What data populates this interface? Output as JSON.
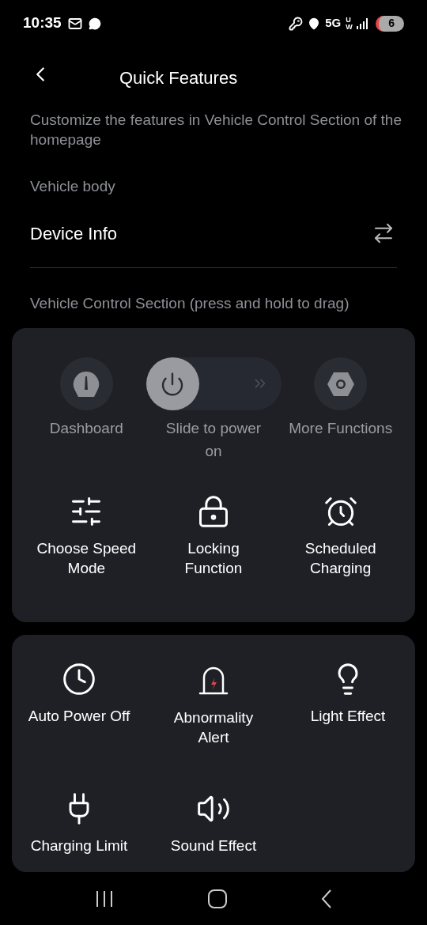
{
  "status_bar": {
    "time": "10:35",
    "network": "5G",
    "network_sub": "UW",
    "battery": "6"
  },
  "header": {
    "title": "Quick Features"
  },
  "description": "Customize the features in Vehicle Control Section of the homepage",
  "vehicle_body": {
    "label": "Vehicle body",
    "item": "Device Info"
  },
  "section_label": "Vehicle Control Section (press and hold to drag)",
  "top_controls": [
    {
      "kind": "dashboard",
      "label": "Dashboard"
    },
    {
      "kind": "slider",
      "label": "Slide to power on",
      "level": 0
    },
    {
      "kind": "more",
      "label": "More Functions"
    }
  ],
  "card_features": [
    {
      "kind": "speed",
      "label": "Choose Speed Mode"
    },
    {
      "kind": "lock",
      "label": "Locking Function"
    },
    {
      "kind": "alarm",
      "label": "Scheduled Charging"
    }
  ],
  "more_features": [
    {
      "kind": "clock",
      "label": "Auto Power Off"
    },
    {
      "kind": "siren",
      "label": "Abnormality Alert"
    },
    {
      "kind": "bulb",
      "label": "Light Effect"
    },
    {
      "kind": "plug",
      "label": "Charging Limit"
    },
    {
      "kind": "speaker",
      "label": "Sound Effect"
    }
  ]
}
